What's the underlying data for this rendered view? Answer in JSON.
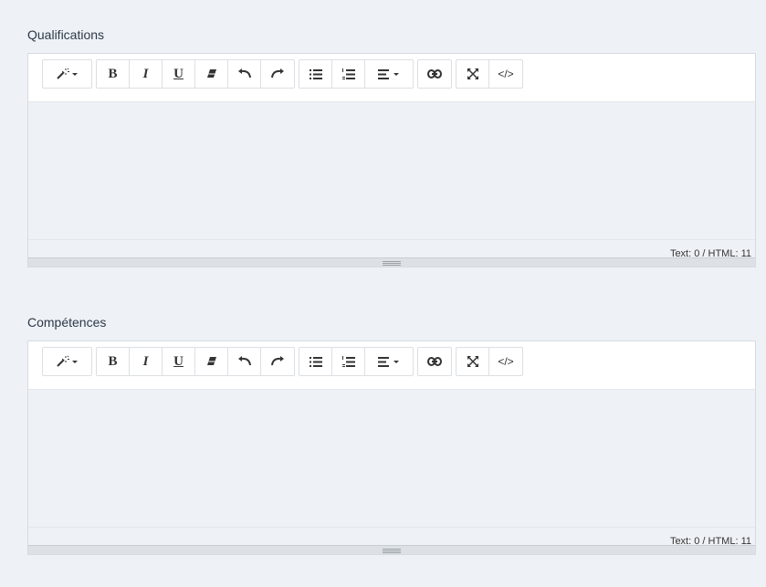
{
  "fields": [
    {
      "label": "Qualifications",
      "status": "Text: 0 / HTML: 11",
      "toolbar": {
        "bold": "B",
        "italic": "I",
        "underline": "U",
        "code": "</>"
      }
    },
    {
      "label": "Compétences",
      "status": "Text: 0 / HTML: 11",
      "toolbar": {
        "bold": "B",
        "italic": "I",
        "underline": "U",
        "code": "</>"
      }
    }
  ],
  "icons": [
    "magic-icon",
    "eraser-icon",
    "undo-icon",
    "redo-icon",
    "bullet-list-icon",
    "numbered-list-icon",
    "align-icon",
    "link-icon",
    "fullscreen-icon",
    "code-view-icon"
  ],
  "colors": {
    "background": "#eef2f6",
    "toolbar": "#ffffff",
    "border": "#d6dbe0"
  }
}
